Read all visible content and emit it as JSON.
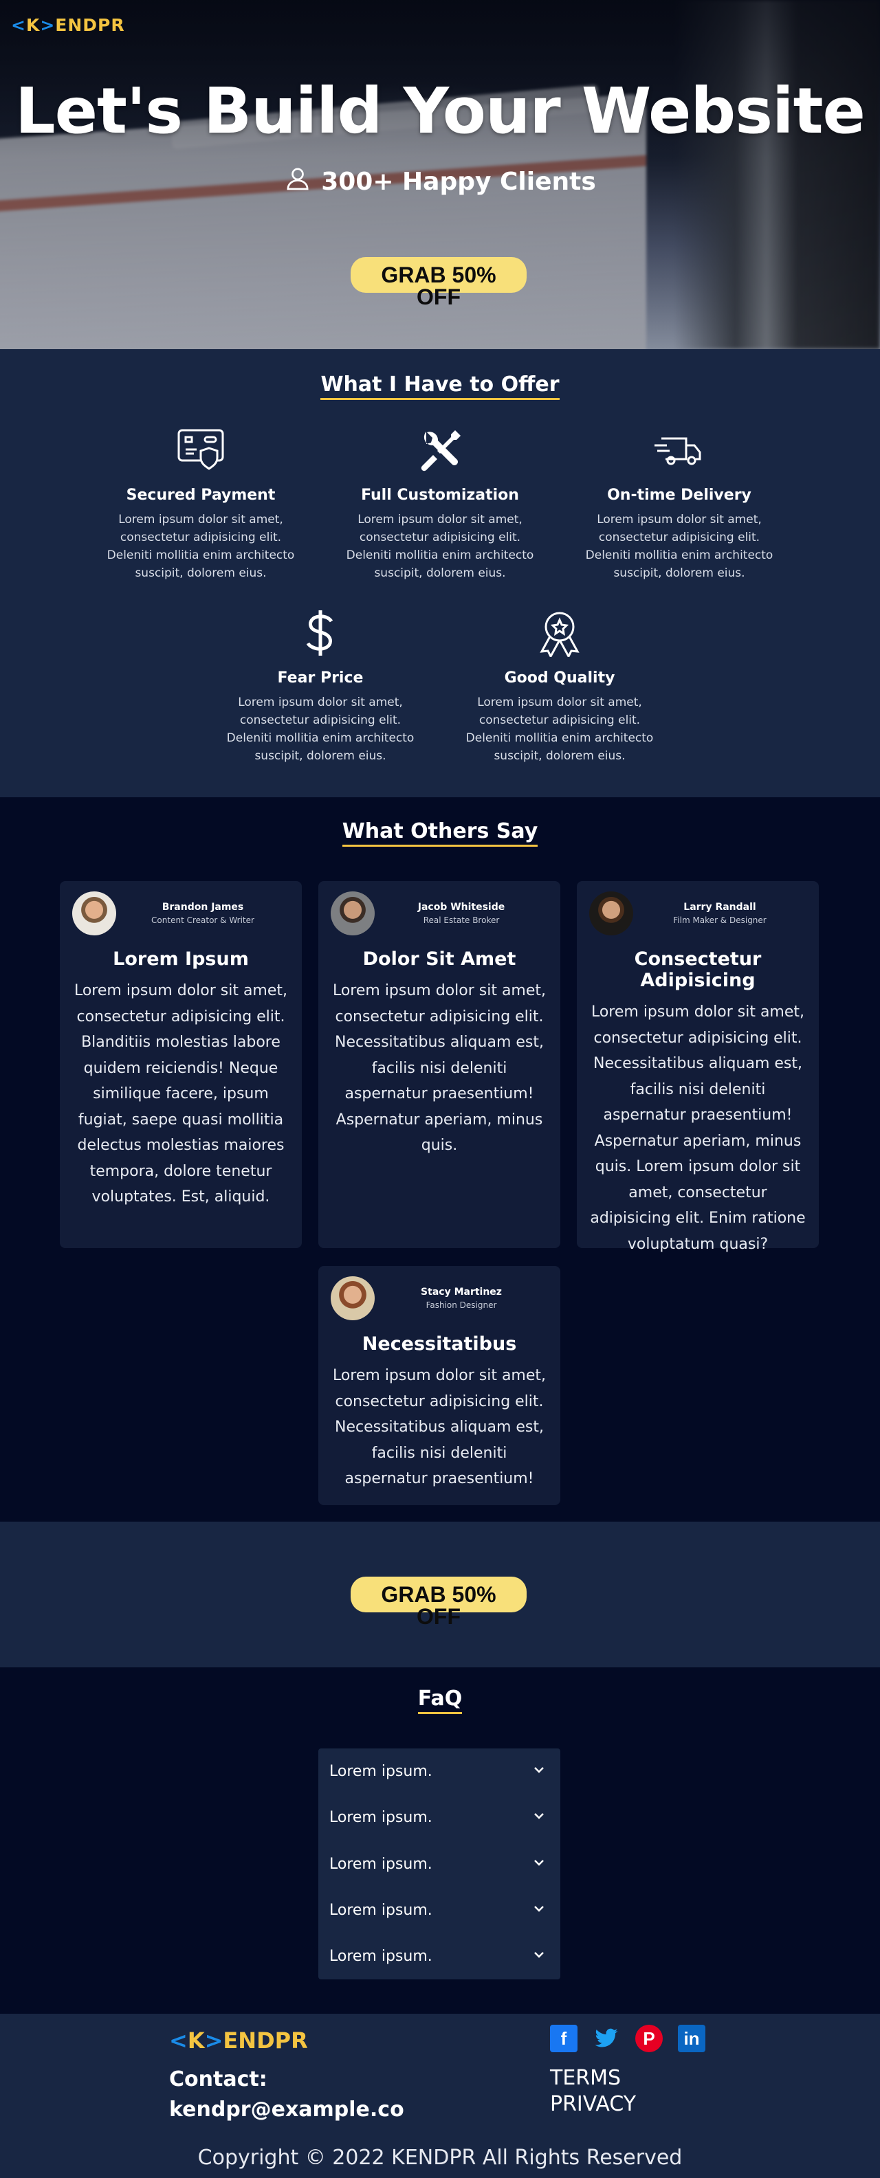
{
  "brand": {
    "logo_lt": "<",
    "logo_k": "K",
    "logo_gt": ">",
    "logo_rest": "ENDPR"
  },
  "hero": {
    "title": "Let's Build Your Website",
    "subtitle": "300+ Happy Clients",
    "cta": "GRAB 50% OFF"
  },
  "offer": {
    "title": "What I Have to Offer",
    "features": [
      {
        "icon": "credit-card-shield-icon",
        "title": "Secured Payment",
        "text": "Lorem ipsum dolor sit amet, consectetur adipisicing elit. Deleniti mollitia enim architecto suscipit, dolorem eius."
      },
      {
        "icon": "wrench-screwdriver-icon",
        "title": "Full Customization",
        "text": "Lorem ipsum dolor sit amet, consectetur adipisicing elit. Deleniti mollitia enim architecto suscipit, dolorem eius."
      },
      {
        "icon": "truck-icon",
        "title": "On-time Delivery",
        "text": "Lorem ipsum dolor sit amet, consectetur adipisicing elit. Deleniti mollitia enim architecto suscipit, dolorem eius."
      },
      {
        "icon": "dollar-icon",
        "title": "Fear Price",
        "text": "Lorem ipsum dolor sit amet, consectetur adipisicing elit. Deleniti mollitia enim architecto suscipit, dolorem eius."
      },
      {
        "icon": "award-ribbon-icon",
        "title": "Good Quality",
        "text": "Lorem ipsum dolor sit amet, consectetur adipisicing elit. Deleniti mollitia enim architecto suscipit, dolorem eius."
      }
    ]
  },
  "testimonials": {
    "title": "What Others Say",
    "cards": [
      {
        "name": "Brandon James",
        "role": "Content Creator & Writer",
        "heading": "Lorem Ipsum",
        "text": "Lorem ipsum dolor sit amet, consectetur adipisicing elit. Blanditiis molestias labore quidem reiciendis! Neque similique facere, ipsum fugiat, saepe quasi mollitia delectus molestias maiores tempora, dolore tenetur voluptates. Est, aliquid."
      },
      {
        "name": "Jacob Whiteside",
        "role": "Real Estate Broker",
        "heading": "Dolor Sit Amet",
        "text": "Lorem ipsum dolor sit amet, consectetur adipisicing elit. Necessitatibus aliquam est, facilis nisi deleniti aspernatur praesentium! Aspernatur aperiam, minus quis."
      },
      {
        "name": "Larry Randall",
        "role": "Film Maker & Designer",
        "heading": "Consectetur Adipisicing",
        "text": "Lorem ipsum dolor sit amet, consectetur adipisicing elit. Necessitatibus aliquam est, facilis nisi deleniti aspernatur praesentium! Aspernatur aperiam, minus quis. Lorem ipsum dolor sit amet, consectetur adipisicing elit. Enim ratione voluptatum quasi?"
      },
      {
        "name": "Stacy Martinez",
        "role": "Fashion Designer",
        "heading": "Necessitatibus",
        "text": "Lorem ipsum dolor sit amet, consectetur adipisicing elit. Necessitatibus aliquam est, facilis nisi deleniti aspernatur praesentium!"
      }
    ]
  },
  "band": {
    "cta": "GRAB 50% OFF"
  },
  "faq": {
    "title": "FaQ",
    "items": [
      "Lorem ipsum.",
      "Lorem ipsum.",
      "Lorem ipsum.",
      "Lorem ipsum.",
      "Lorem ipsum."
    ]
  },
  "footer": {
    "contact_label": "Contact:",
    "email": "kendpr@example.co",
    "socials": [
      {
        "icon": "facebook-icon",
        "glyph": "f"
      },
      {
        "icon": "twitter-icon",
        "glyph": "🐦"
      },
      {
        "icon": "pinterest-icon",
        "glyph": "P"
      },
      {
        "icon": "linkedin-icon",
        "glyph": "in"
      }
    ],
    "terms": "TERMS",
    "privacy": "PRIVACY",
    "copyright": "Copyright © 2022 KENDPR All Rights Reserved"
  },
  "colors": {
    "accent": "#f4c441",
    "brand_blue": "#1a8be8",
    "navy": "#182643",
    "dark": "#030a24",
    "cta_bg": "#f8e07a"
  }
}
